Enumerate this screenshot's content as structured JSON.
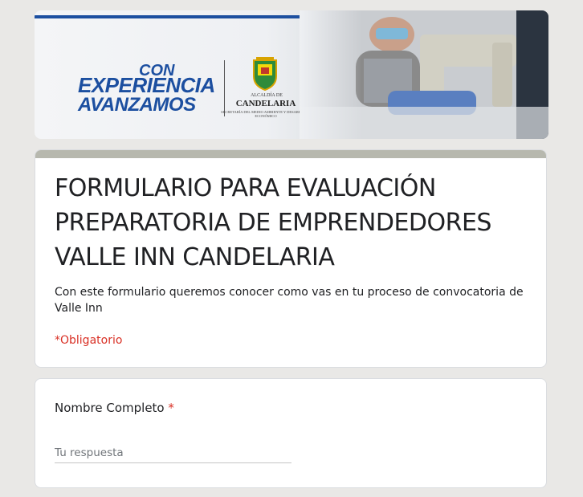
{
  "banner": {
    "logo_con": "CON",
    "logo_experiencia": "EXPERIENCIA",
    "logo_avanzamos": "AVANZAMOS",
    "alcaldia_small": "ALCALDÍA DE",
    "alcaldia_name": "CANDELARIA",
    "alcaldia_sub": "SECRETARÍA DEL MEDIO AMBIENTE Y DESARROLLO ECONÓMICO",
    "colors": {
      "brand_blue": "#1c4fa0",
      "stripe_yellow": "#f5d90a",
      "stripe_green": "#2e9e4f"
    }
  },
  "form": {
    "title": "FORMULARIO PARA EVALUACIÓN PREPARATORIA DE EMPRENDEDORES VALLE INN CANDELARIA",
    "description": "Con este formulario queremos conocer como vas en tu proceso de convocatoria de Valle Inn",
    "required_note": "*Obligatorio",
    "header_color": "#b7b8ae"
  },
  "question": {
    "label": "Nombre Completo",
    "required_mark": "*",
    "placeholder": "Tu respuesta",
    "value": ""
  }
}
